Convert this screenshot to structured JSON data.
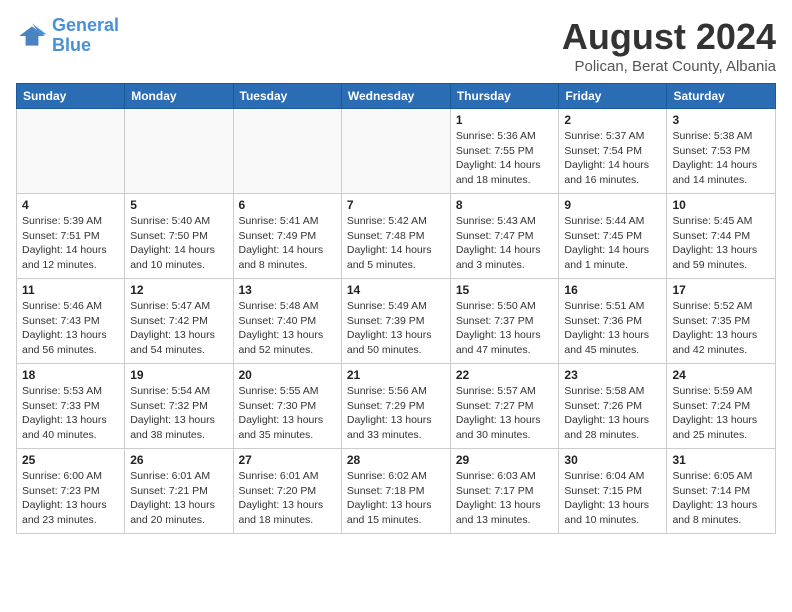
{
  "logo": {
    "line1": "General",
    "line2": "Blue"
  },
  "title": "August 2024",
  "subtitle": "Polican, Berat County, Albania",
  "days_of_week": [
    "Sunday",
    "Monday",
    "Tuesday",
    "Wednesday",
    "Thursday",
    "Friday",
    "Saturday"
  ],
  "weeks": [
    [
      {
        "day": "",
        "info": ""
      },
      {
        "day": "",
        "info": ""
      },
      {
        "day": "",
        "info": ""
      },
      {
        "day": "",
        "info": ""
      },
      {
        "day": "1",
        "info": "Sunrise: 5:36 AM\nSunset: 7:55 PM\nDaylight: 14 hours\nand 18 minutes."
      },
      {
        "day": "2",
        "info": "Sunrise: 5:37 AM\nSunset: 7:54 PM\nDaylight: 14 hours\nand 16 minutes."
      },
      {
        "day": "3",
        "info": "Sunrise: 5:38 AM\nSunset: 7:53 PM\nDaylight: 14 hours\nand 14 minutes."
      }
    ],
    [
      {
        "day": "4",
        "info": "Sunrise: 5:39 AM\nSunset: 7:51 PM\nDaylight: 14 hours\nand 12 minutes."
      },
      {
        "day": "5",
        "info": "Sunrise: 5:40 AM\nSunset: 7:50 PM\nDaylight: 14 hours\nand 10 minutes."
      },
      {
        "day": "6",
        "info": "Sunrise: 5:41 AM\nSunset: 7:49 PM\nDaylight: 14 hours\nand 8 minutes."
      },
      {
        "day": "7",
        "info": "Sunrise: 5:42 AM\nSunset: 7:48 PM\nDaylight: 14 hours\nand 5 minutes."
      },
      {
        "day": "8",
        "info": "Sunrise: 5:43 AM\nSunset: 7:47 PM\nDaylight: 14 hours\nand 3 minutes."
      },
      {
        "day": "9",
        "info": "Sunrise: 5:44 AM\nSunset: 7:45 PM\nDaylight: 14 hours\nand 1 minute."
      },
      {
        "day": "10",
        "info": "Sunrise: 5:45 AM\nSunset: 7:44 PM\nDaylight: 13 hours\nand 59 minutes."
      }
    ],
    [
      {
        "day": "11",
        "info": "Sunrise: 5:46 AM\nSunset: 7:43 PM\nDaylight: 13 hours\nand 56 minutes."
      },
      {
        "day": "12",
        "info": "Sunrise: 5:47 AM\nSunset: 7:42 PM\nDaylight: 13 hours\nand 54 minutes."
      },
      {
        "day": "13",
        "info": "Sunrise: 5:48 AM\nSunset: 7:40 PM\nDaylight: 13 hours\nand 52 minutes."
      },
      {
        "day": "14",
        "info": "Sunrise: 5:49 AM\nSunset: 7:39 PM\nDaylight: 13 hours\nand 50 minutes."
      },
      {
        "day": "15",
        "info": "Sunrise: 5:50 AM\nSunset: 7:37 PM\nDaylight: 13 hours\nand 47 minutes."
      },
      {
        "day": "16",
        "info": "Sunrise: 5:51 AM\nSunset: 7:36 PM\nDaylight: 13 hours\nand 45 minutes."
      },
      {
        "day": "17",
        "info": "Sunrise: 5:52 AM\nSunset: 7:35 PM\nDaylight: 13 hours\nand 42 minutes."
      }
    ],
    [
      {
        "day": "18",
        "info": "Sunrise: 5:53 AM\nSunset: 7:33 PM\nDaylight: 13 hours\nand 40 minutes."
      },
      {
        "day": "19",
        "info": "Sunrise: 5:54 AM\nSunset: 7:32 PM\nDaylight: 13 hours\nand 38 minutes."
      },
      {
        "day": "20",
        "info": "Sunrise: 5:55 AM\nSunset: 7:30 PM\nDaylight: 13 hours\nand 35 minutes."
      },
      {
        "day": "21",
        "info": "Sunrise: 5:56 AM\nSunset: 7:29 PM\nDaylight: 13 hours\nand 33 minutes."
      },
      {
        "day": "22",
        "info": "Sunrise: 5:57 AM\nSunset: 7:27 PM\nDaylight: 13 hours\nand 30 minutes."
      },
      {
        "day": "23",
        "info": "Sunrise: 5:58 AM\nSunset: 7:26 PM\nDaylight: 13 hours\nand 28 minutes."
      },
      {
        "day": "24",
        "info": "Sunrise: 5:59 AM\nSunset: 7:24 PM\nDaylight: 13 hours\nand 25 minutes."
      }
    ],
    [
      {
        "day": "25",
        "info": "Sunrise: 6:00 AM\nSunset: 7:23 PM\nDaylight: 13 hours\nand 23 minutes."
      },
      {
        "day": "26",
        "info": "Sunrise: 6:01 AM\nSunset: 7:21 PM\nDaylight: 13 hours\nand 20 minutes."
      },
      {
        "day": "27",
        "info": "Sunrise: 6:01 AM\nSunset: 7:20 PM\nDaylight: 13 hours\nand 18 minutes."
      },
      {
        "day": "28",
        "info": "Sunrise: 6:02 AM\nSunset: 7:18 PM\nDaylight: 13 hours\nand 15 minutes."
      },
      {
        "day": "29",
        "info": "Sunrise: 6:03 AM\nSunset: 7:17 PM\nDaylight: 13 hours\nand 13 minutes."
      },
      {
        "day": "30",
        "info": "Sunrise: 6:04 AM\nSunset: 7:15 PM\nDaylight: 13 hours\nand 10 minutes."
      },
      {
        "day": "31",
        "info": "Sunrise: 6:05 AM\nSunset: 7:14 PM\nDaylight: 13 hours\nand 8 minutes."
      }
    ]
  ]
}
